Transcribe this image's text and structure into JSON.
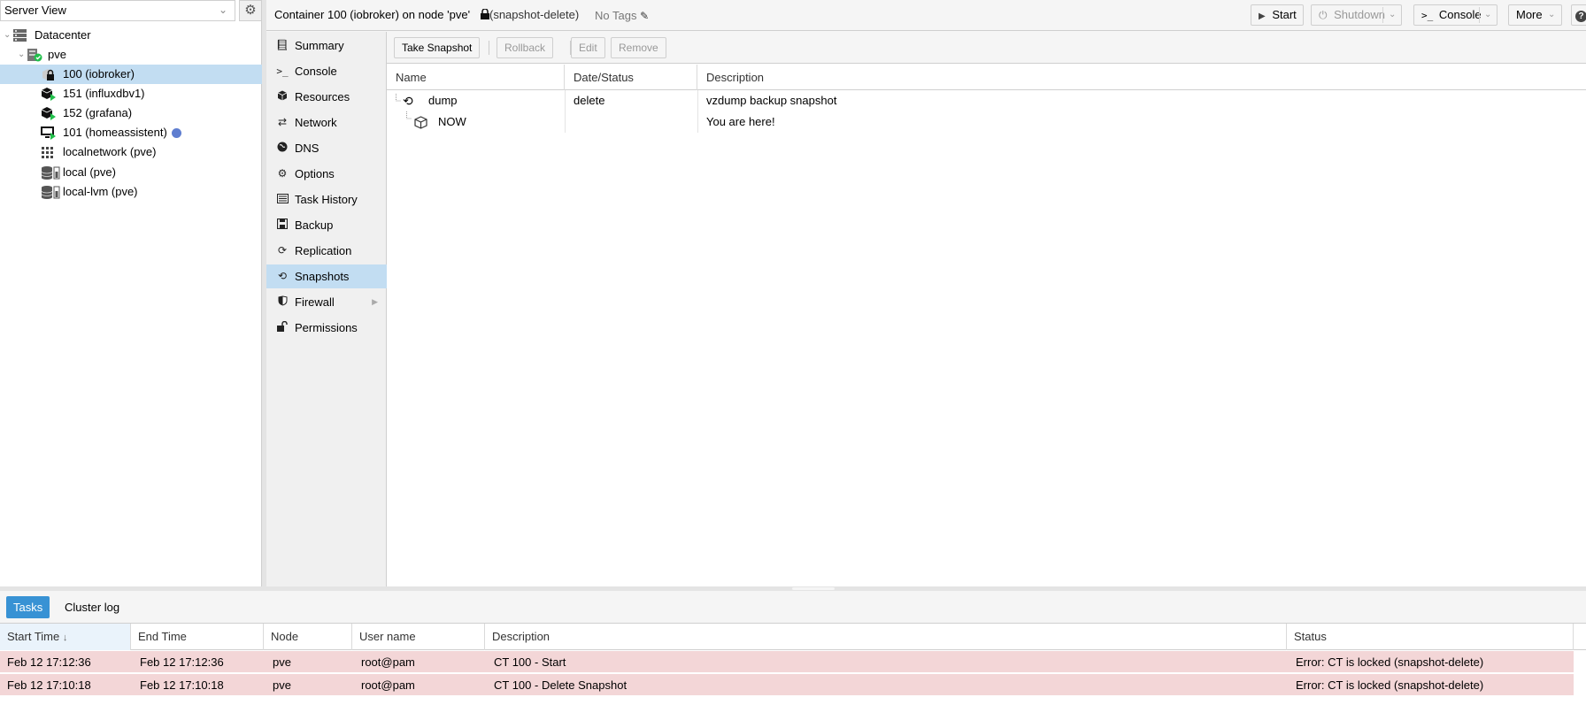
{
  "tree": {
    "view_label": "Server View",
    "items": [
      {
        "label": "Datacenter",
        "icon": "datacenter-icon"
      },
      {
        "label": "pve",
        "icon": "server-online-icon"
      },
      {
        "label": "100 (iobroker)",
        "icon": "container-locked-icon"
      },
      {
        "label": "151 (influxdbv1)",
        "icon": "container-running-icon"
      },
      {
        "label": "152 (grafana)",
        "icon": "container-running-icon"
      },
      {
        "label": "101 (homeassistent)",
        "icon": "vm-running-icon"
      },
      {
        "label": "localnetwork (pve)",
        "icon": "sdn-grid-icon"
      },
      {
        "label": "local (pve)",
        "icon": "storage-icon"
      },
      {
        "label": "local-lvm (pve)",
        "icon": "storage-icon"
      }
    ]
  },
  "header": {
    "title": "Container 100 (iobroker) on node 'pve'",
    "lock_status": "(snapshot-delete)",
    "tags": "No Tags",
    "buttons": {
      "start": "Start",
      "shutdown": "Shutdown",
      "console": "Console",
      "more": "More"
    }
  },
  "nav": {
    "items": [
      {
        "label": "Summary",
        "icon": "book-icon"
      },
      {
        "label": "Console",
        "icon": "terminal-icon"
      },
      {
        "label": "Resources",
        "icon": "cube-icon"
      },
      {
        "label": "Network",
        "icon": "exchange-icon"
      },
      {
        "label": "DNS",
        "icon": "globe-icon"
      },
      {
        "label": "Options",
        "icon": "gear-icon"
      },
      {
        "label": "Task History",
        "icon": "list-alt-icon"
      },
      {
        "label": "Backup",
        "icon": "floppy-icon"
      },
      {
        "label": "Replication",
        "icon": "retweet-icon"
      },
      {
        "label": "Snapshots",
        "icon": "history-icon"
      },
      {
        "label": "Firewall",
        "icon": "shield-icon"
      },
      {
        "label": "Permissions",
        "icon": "unlock-icon"
      }
    ],
    "active": "Snapshots"
  },
  "snapshots": {
    "toolbar": {
      "take": "Take Snapshot",
      "rollback": "Rollback",
      "edit": "Edit",
      "remove": "Remove"
    },
    "columns": [
      "Name",
      "Date/Status",
      "Description"
    ],
    "rows": [
      {
        "name": "dump",
        "status": "delete",
        "description": "vzdump backup snapshot"
      },
      {
        "name": "NOW",
        "status": "",
        "description": "You are here!"
      }
    ]
  },
  "tasks": {
    "tabs": [
      "Tasks",
      "Cluster log"
    ],
    "columns": [
      "Start Time",
      "End Time",
      "Node",
      "User name",
      "Description",
      "Status"
    ],
    "rows": [
      {
        "start": "Feb 12 17:12:36",
        "end": "Feb 12 17:12:36",
        "node": "pve",
        "user": "root@pam",
        "description": "CT 100 - Start",
        "status": "Error: CT is locked (snapshot-delete)"
      },
      {
        "start": "Feb 12 17:10:18",
        "end": "Feb 12 17:10:18",
        "node": "pve",
        "user": "root@pam",
        "description": "CT 100 - Delete Snapshot",
        "status": "Error: CT is locked (snapshot-delete)"
      }
    ]
  },
  "colors": {
    "selection": "#c2ddf2",
    "accent": "#3892d4",
    "error_row": "#f3d6d7",
    "running": "#21bf4b"
  }
}
